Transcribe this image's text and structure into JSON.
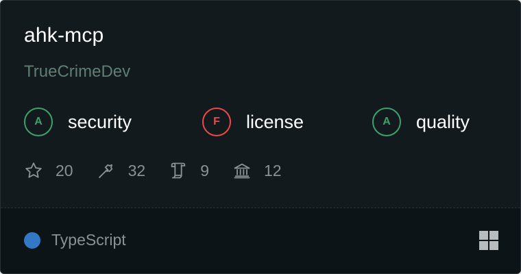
{
  "card": {
    "title": "ahk-mcp",
    "owner": "TrueCrimeDev",
    "grades": [
      {
        "letter": "A",
        "label": "security",
        "status_color": "#3aa36a"
      },
      {
        "letter": "F",
        "label": "license",
        "status_color": "#f04848"
      },
      {
        "letter": "A",
        "label": "quality",
        "status_color": "#3aa36a"
      }
    ],
    "stats": [
      {
        "icon": "star-icon",
        "value": "20"
      },
      {
        "icon": "hammer-icon",
        "value": "32"
      },
      {
        "icon": "scroll-icon",
        "value": "9"
      },
      {
        "icon": "bank-icon",
        "value": "12"
      }
    ],
    "language": {
      "name": "TypeScript",
      "color": "#3178c6"
    },
    "footer_icon": "grid-icon"
  }
}
